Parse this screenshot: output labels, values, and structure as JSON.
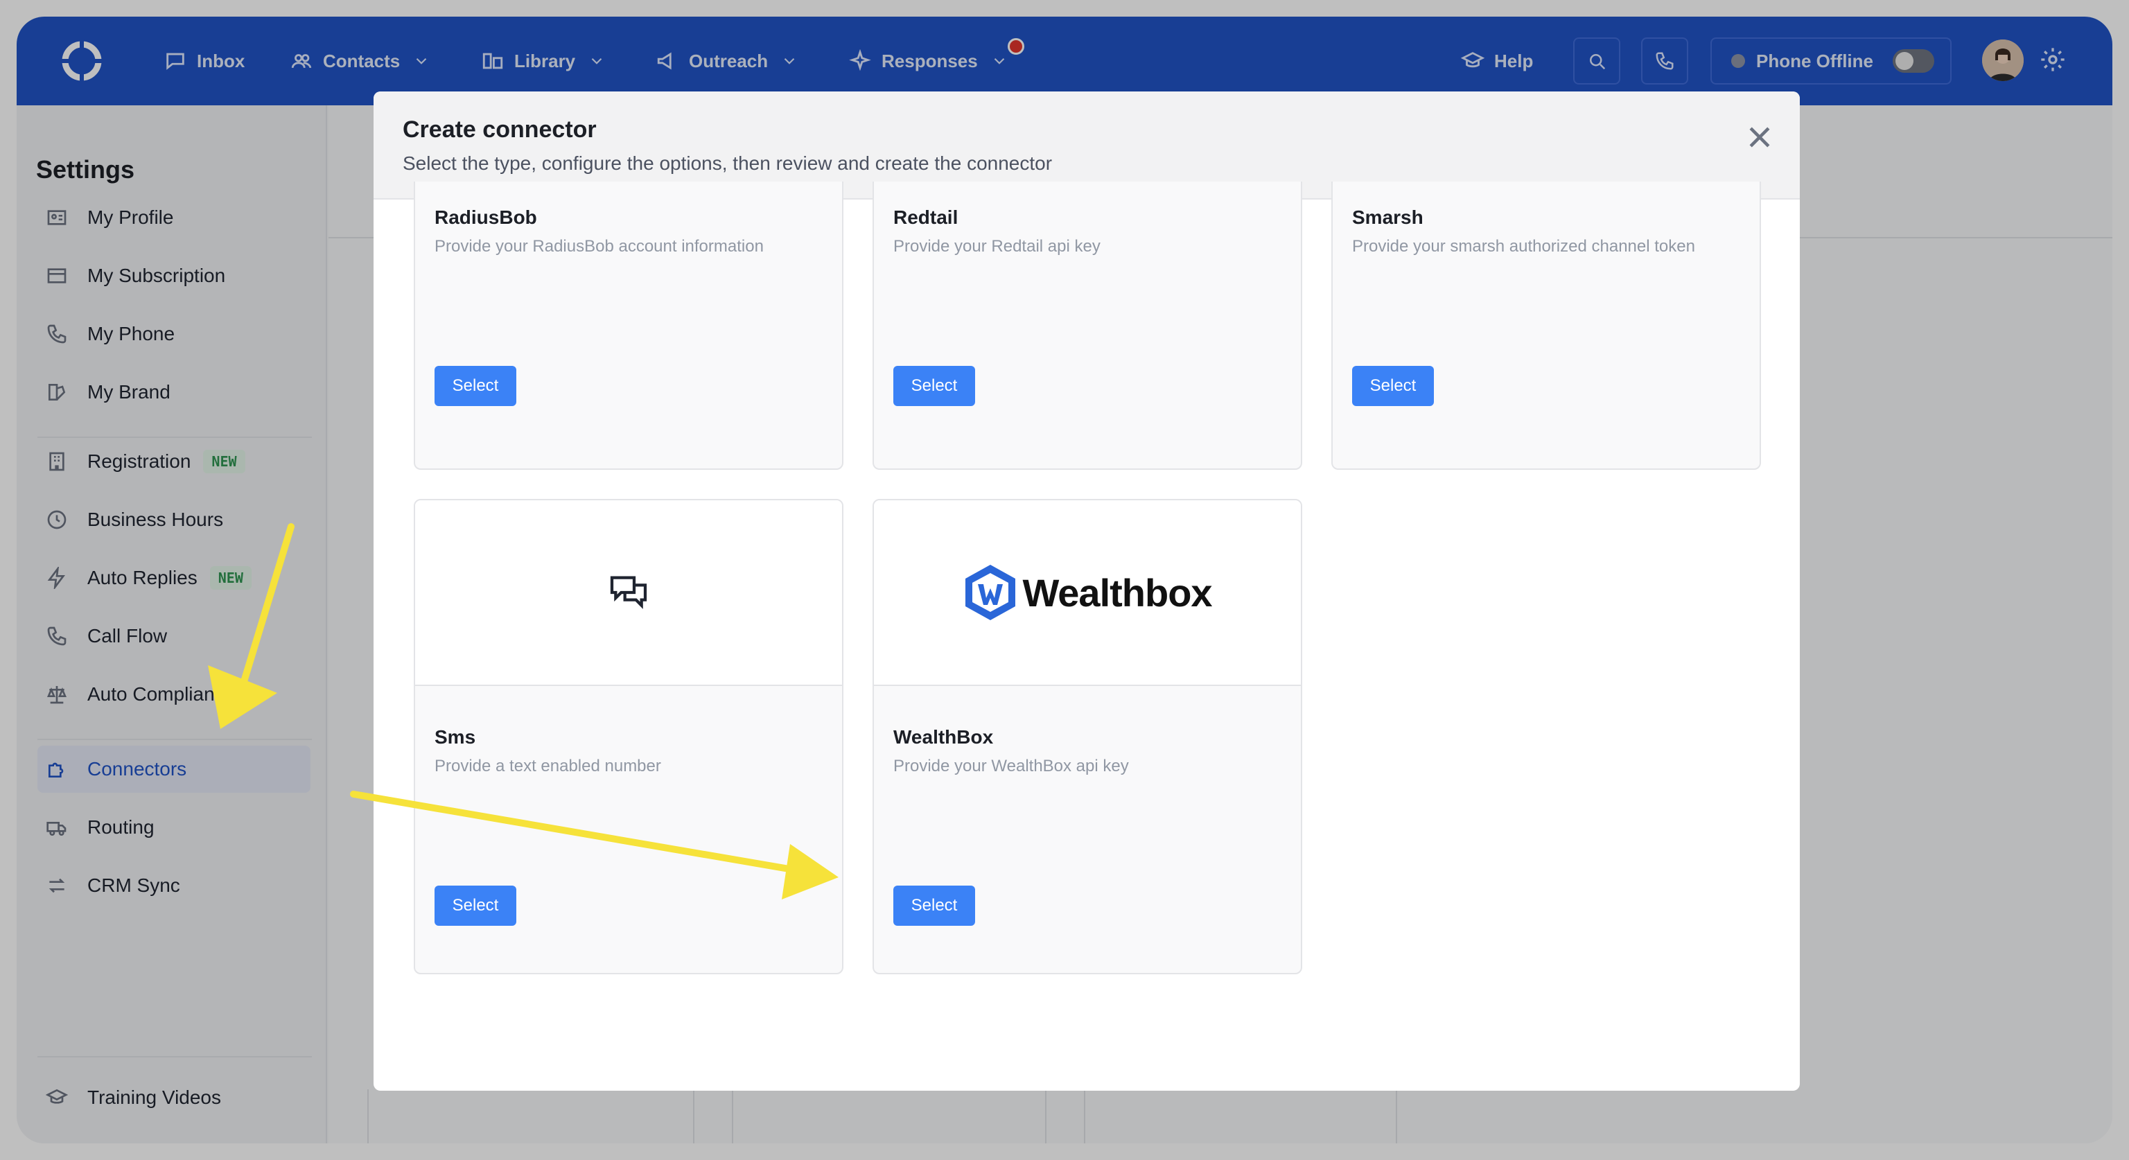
{
  "nav": {
    "inbox": "Inbox",
    "contacts": "Contacts",
    "library": "Library",
    "outreach": "Outreach",
    "responses": "Responses",
    "help": "Help",
    "phone_status": "Phone Offline"
  },
  "sidebar": {
    "title": "Settings",
    "items": [
      {
        "label": "My Profile",
        "icon": "id-card-icon"
      },
      {
        "label": "My Subscription",
        "icon": "credit-card-icon"
      },
      {
        "label": "My Phone",
        "icon": "phone-icon"
      },
      {
        "label": "My Brand",
        "icon": "brand-icon"
      },
      {
        "label": "Registration",
        "icon": "building-icon",
        "badge": "NEW"
      },
      {
        "label": "Business Hours",
        "icon": "clock-icon"
      },
      {
        "label": "Auto Replies",
        "icon": "bolt-icon",
        "badge": "NEW"
      },
      {
        "label": "Call Flow",
        "icon": "call-flow-icon"
      },
      {
        "label": "Auto Compliance",
        "icon": "scale-icon"
      },
      {
        "label": "Connectors",
        "icon": "puzzle-icon",
        "active": true
      },
      {
        "label": "Routing",
        "icon": "truck-icon"
      },
      {
        "label": "CRM Sync",
        "icon": "sync-icon"
      },
      {
        "label": "Training Videos",
        "icon": "graduation-cap-icon"
      }
    ]
  },
  "modal": {
    "title": "Create connector",
    "subtitle": "Select the type, configure the options, then review and create the connector",
    "cards": [
      {
        "name": "RadiusBob",
        "desc": "Provide your RadiusBob account information",
        "button": "Select"
      },
      {
        "name": "Redtail",
        "desc": "Provide your Redtail api key",
        "button": "Select"
      },
      {
        "name": "Smarsh",
        "desc": "Provide your smarsh authorized channel token",
        "button": "Select"
      },
      {
        "name": "Sms",
        "desc": "Provide a text enabled number",
        "button": "Select",
        "logo": "chat-bubbles-icon"
      },
      {
        "name": "WealthBox",
        "desc": "Provide your WealthBox api key",
        "button": "Select",
        "logo_text": "Wealthbox"
      }
    ]
  },
  "colors": {
    "nav": "#2153c6",
    "accent": "#3b82f6",
    "arrow": "#f6e23a"
  }
}
